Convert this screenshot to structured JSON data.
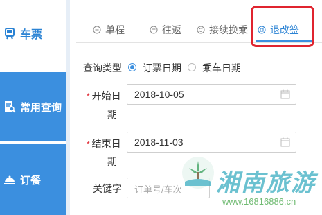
{
  "sidebar": {
    "items": [
      {
        "label": "车票",
        "icon": "train-icon",
        "active": true
      },
      {
        "label": "常用查询",
        "icon": "document-search-icon",
        "active": false
      },
      {
        "label": "订餐",
        "icon": "meal-bell-icon",
        "active": false
      }
    ]
  },
  "tabs": [
    {
      "label": "单程",
      "icon": "minus-circle-icon"
    },
    {
      "label": "往返",
      "icon": "equals-circle-icon"
    },
    {
      "label": "接续换乘",
      "icon": "swap-circle-icon"
    },
    {
      "label": "退改签",
      "icon": "refund-circle-icon",
      "selected": true
    }
  ],
  "form": {
    "query_type": {
      "label": "查询类型",
      "options": [
        "订票日期",
        "乘车日期"
      ],
      "selected": "订票日期"
    },
    "start_date": {
      "label_line1": "开始日",
      "label_line2": "期",
      "value": "2018-10-05",
      "required_mark": "*"
    },
    "end_date": {
      "label_line1": "结束日",
      "label_line2": "期",
      "value": "2018-11-03",
      "required_mark": "*"
    },
    "keyword": {
      "label": "关键字",
      "placeholder": "订单号/车次"
    }
  },
  "watermark": {
    "text": "湘南旅游",
    "url": "www.16816886.cn"
  },
  "colors": {
    "accent": "#3b8fdf",
    "highlight": "#e0242f",
    "sidebar_blue": "#3b8fdf"
  }
}
